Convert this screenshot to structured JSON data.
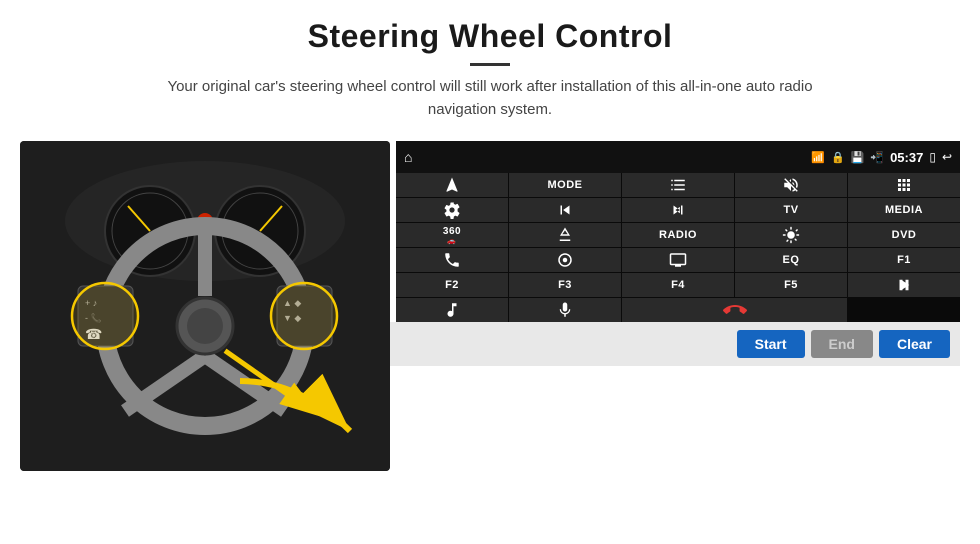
{
  "header": {
    "title": "Steering Wheel Control",
    "subtitle": "Your original car's steering wheel control will still work after installation of this all-in-one auto radio navigation system."
  },
  "status_bar": {
    "time": "05:37",
    "icons": [
      "wifi",
      "lock",
      "sd-card",
      "bluetooth",
      "cast",
      "back"
    ]
  },
  "button_grid": [
    {
      "id": "nav",
      "label": "",
      "icon": "navigate",
      "type": "icon"
    },
    {
      "id": "mode",
      "label": "MODE",
      "type": "text"
    },
    {
      "id": "list",
      "label": "",
      "icon": "list",
      "type": "icon"
    },
    {
      "id": "mute",
      "label": "",
      "icon": "mute",
      "type": "icon"
    },
    {
      "id": "apps",
      "label": "",
      "icon": "apps",
      "type": "icon"
    },
    {
      "id": "settings-360",
      "label": "",
      "icon": "settings-circle",
      "type": "icon"
    },
    {
      "id": "prev",
      "label": "",
      "icon": "prev",
      "type": "icon"
    },
    {
      "id": "next",
      "label": "",
      "icon": "next",
      "type": "icon"
    },
    {
      "id": "tv",
      "label": "TV",
      "type": "text"
    },
    {
      "id": "media",
      "label": "MEDIA",
      "type": "text"
    },
    {
      "id": "cam360",
      "label": "360",
      "sublabel": "cam",
      "type": "text-small"
    },
    {
      "id": "eject",
      "label": "",
      "icon": "eject",
      "type": "icon"
    },
    {
      "id": "radio",
      "label": "RADIO",
      "type": "text"
    },
    {
      "id": "brightness",
      "label": "",
      "icon": "brightness",
      "type": "icon"
    },
    {
      "id": "dvd",
      "label": "DVD",
      "type": "text"
    },
    {
      "id": "phone",
      "label": "",
      "icon": "phone",
      "type": "icon"
    },
    {
      "id": "navi-circle",
      "label": "",
      "icon": "navi-circle",
      "type": "icon"
    },
    {
      "id": "screen",
      "label": "",
      "icon": "screen",
      "type": "icon"
    },
    {
      "id": "eq",
      "label": "EQ",
      "type": "text"
    },
    {
      "id": "f1",
      "label": "F1",
      "type": "text"
    },
    {
      "id": "f2",
      "label": "F2",
      "type": "text"
    },
    {
      "id": "f3",
      "label": "F3",
      "type": "text"
    },
    {
      "id": "f4",
      "label": "F4",
      "type": "text"
    },
    {
      "id": "f5",
      "label": "F5",
      "type": "text"
    },
    {
      "id": "playpause",
      "label": "",
      "icon": "playpause",
      "type": "icon"
    },
    {
      "id": "music",
      "label": "",
      "icon": "music",
      "type": "icon"
    },
    {
      "id": "mic",
      "label": "",
      "icon": "mic",
      "type": "icon"
    },
    {
      "id": "call-end",
      "label": "",
      "icon": "call-end",
      "type": "icon-wide",
      "span": 2
    },
    {
      "id": "placeholder",
      "label": "",
      "type": "empty"
    }
  ],
  "action_bar": {
    "start_label": "Start",
    "end_label": "End",
    "clear_label": "Clear"
  }
}
